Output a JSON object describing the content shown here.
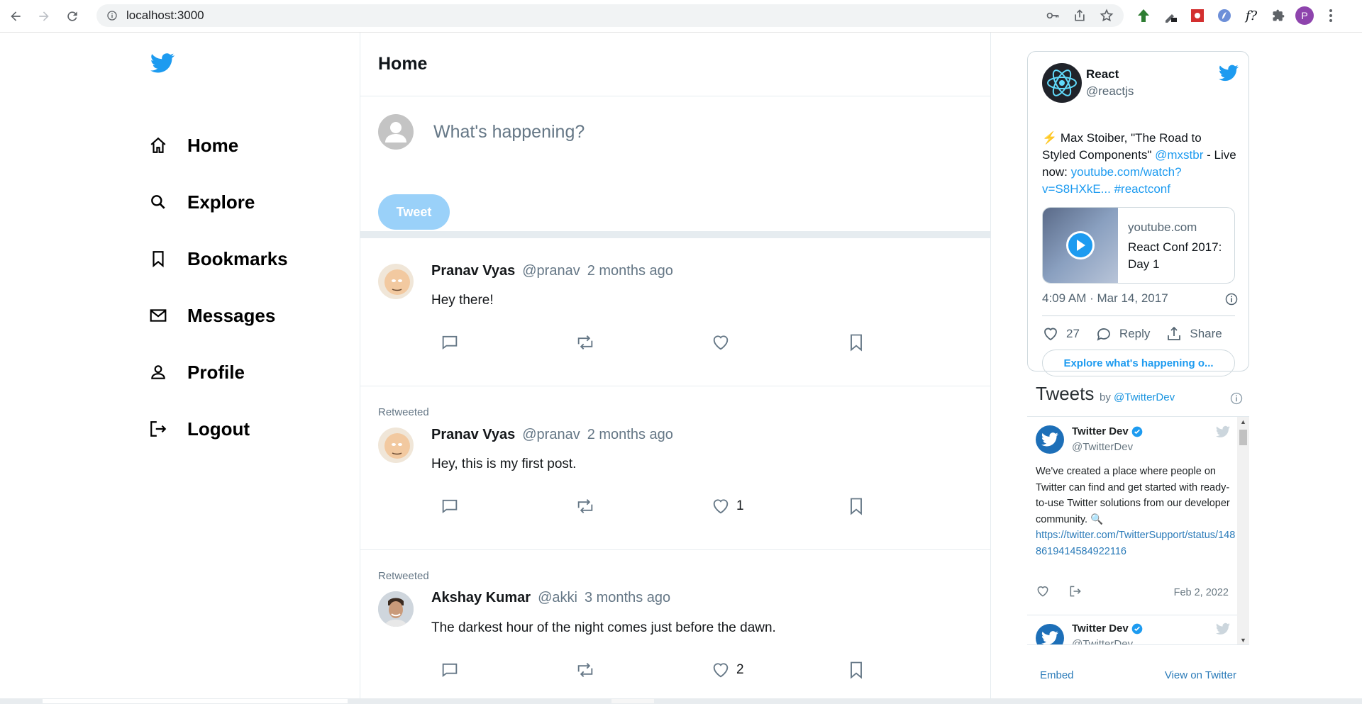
{
  "browser": {
    "url": "localhost:3000",
    "profile_initial": "P"
  },
  "sidebar": {
    "items": [
      {
        "label": "Home",
        "icon": "home-icon"
      },
      {
        "label": "Explore",
        "icon": "search-icon"
      },
      {
        "label": "Bookmarks",
        "icon": "bookmark-icon"
      },
      {
        "label": "Messages",
        "icon": "mail-icon"
      },
      {
        "label": "Profile",
        "icon": "user-icon"
      },
      {
        "label": "Logout",
        "icon": "logout-icon"
      }
    ]
  },
  "main": {
    "title": "Home",
    "composer": {
      "placeholder": "What's happening?",
      "tweet_button": "Tweet"
    },
    "posts": [
      {
        "retweeted": "",
        "name": "Pranav Vyas",
        "handle": "@pranav",
        "time": "2 months ago",
        "text": "Hey there!",
        "likes": ""
      },
      {
        "retweeted": "Retweeted",
        "name": "Pranav Vyas",
        "handle": "@pranav",
        "time": "2 months ago",
        "text": "Hey, this is my first post.",
        "likes": "1"
      },
      {
        "retweeted": "Retweeted",
        "name": "Akshay Kumar",
        "handle": "@akki",
        "time": "3 months ago",
        "text": "The darkest hour of the night comes just before the dawn.",
        "likes": "2"
      }
    ]
  },
  "embed": {
    "name": "React",
    "handle": "@reactjs",
    "text_plain1": "⚡️ Max Stoiber, \"The Road to Styled Components\" ",
    "text_link1": "@mxstbr",
    "text_plain2": " - Live now: ",
    "text_link2": "youtube.com/watch?v=S8HXkE...",
    "text_plain3": " ",
    "text_link3": "#reactconf",
    "media_domain": "youtube.com",
    "media_title": "React Conf 2017: Day 1",
    "date": "4:09 AM · Mar 14, 2017",
    "likes": "27",
    "reply": "Reply",
    "share": "Share",
    "explore": "Explore what's happening o..."
  },
  "timeline": {
    "title": "Tweets",
    "by": "by ",
    "by_link": "@TwitterDev",
    "tweets": [
      {
        "name": "Twitter Dev",
        "handle": "@TwitterDev",
        "text": "We've created a place where people on Twitter can find and get started with ready-to-use Twitter solutions from our developer community. 🔍",
        "link": "https://twitter.com/TwitterSupport/status/1488619414584922116",
        "date": "Feb 2, 2022"
      },
      {
        "name": "Twitter Dev",
        "handle": "@TwitterDev"
      }
    ],
    "embed_label": "Embed",
    "view_label": "View on Twitter"
  },
  "colors": {
    "brand": "#1d9bf0",
    "tweet_button_disabled": "#9ad1f9",
    "muted": "#657786"
  }
}
